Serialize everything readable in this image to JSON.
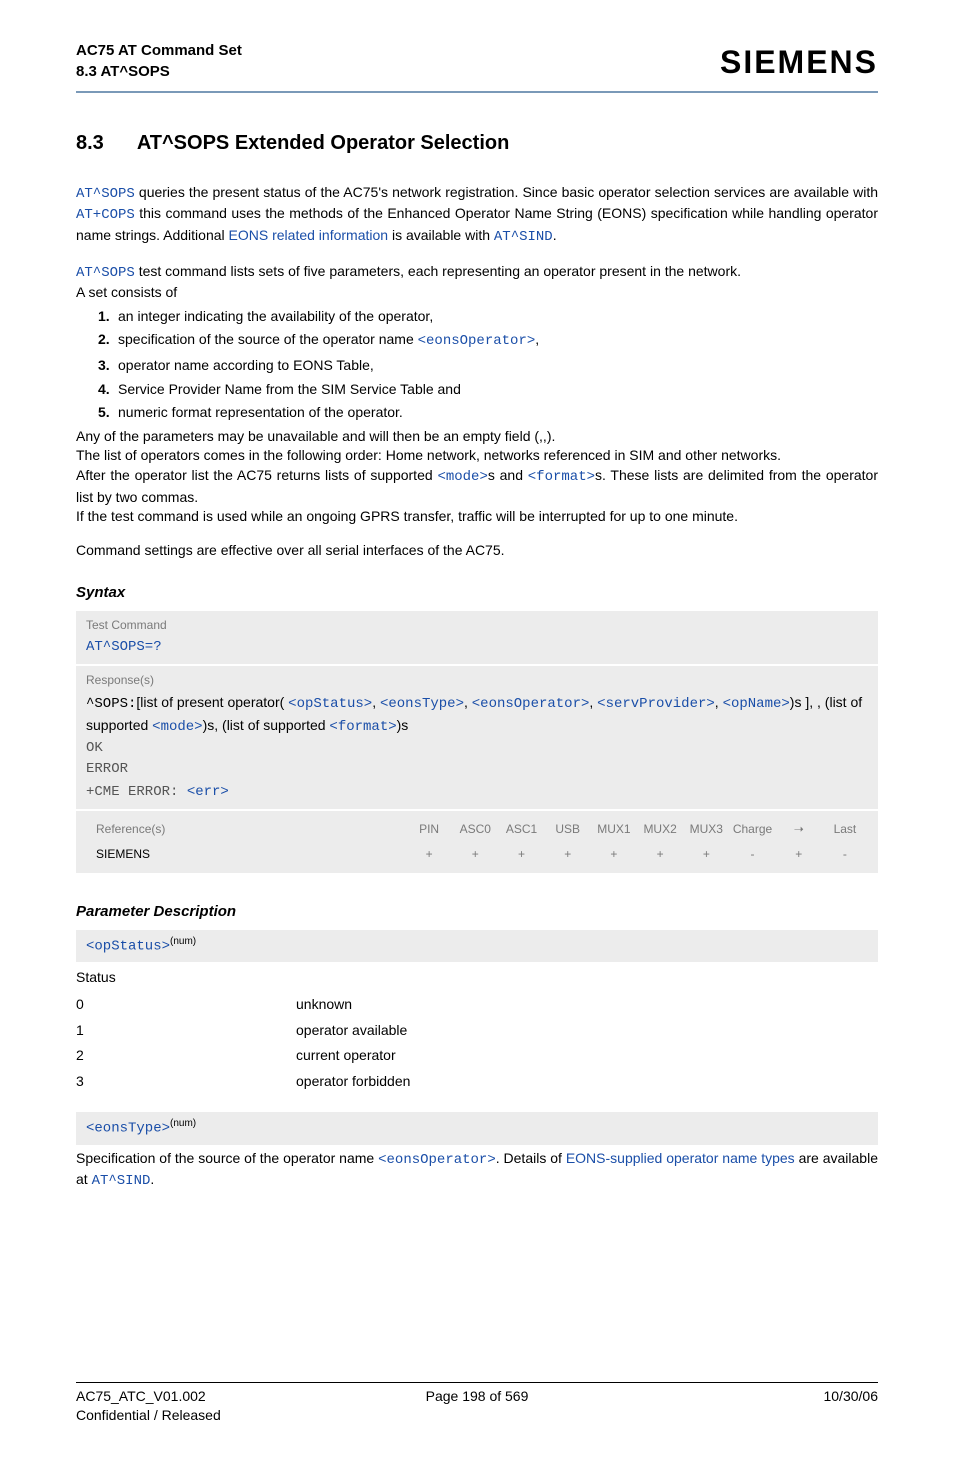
{
  "header": {
    "doc_title": "AC75 AT Command Set",
    "section_ref": "8.3 AT^SOPS",
    "brand": "SIEMENS"
  },
  "section": {
    "number": "8.3",
    "title": "AT^SOPS   Extended Operator Selection"
  },
  "intro": {
    "atsops1": "AT^SOPS",
    "p1a": " queries the present status of the AC75's network registration. Since basic operator selection services are available with ",
    "atcops": "AT+COPS",
    "p1b": " this command uses the methods of the Enhanced Operator Name String (EONS) specification while handling operator name strings. Additional ",
    "eons_link": "EONS related information",
    "p1c": " is available with ",
    "atsind": "AT^SIND",
    "p1d": "."
  },
  "testcmd": {
    "atsops2": "AT^SOPS",
    "p2": " test command lists sets of five parameters, each representing an operator present in the network.",
    "p3": "A set consists of",
    "items": {
      "i1": "an integer indicating the availability of the operator,",
      "i2a": "specification of the source of the operator name ",
      "i2code": "<eonsOperator>",
      "i2b": ",",
      "i3": "operator name according to EONS Table,",
      "i4": "Service Provider Name from the SIM Service Table and",
      "i5": "numeric format representation of the operator."
    },
    "p4": "Any of the parameters may be unavailable and will then be an empty field (,,).",
    "p5": "The list of operators comes in the following order: Home network, networks referenced in SIM and other networks.",
    "p6a": "After the operator list the AC75 returns lists of supported ",
    "mode": "<mode>",
    "p6b": "s and ",
    "format": "<format>",
    "p6c": "s. These lists are delimited from the operator list by two commas.",
    "p7": "If the test command is used while an ongoing GPRS transfer, traffic will be interrupted for up to one minute.",
    "p8": "Command settings are effective over all serial interfaces of the AC75."
  },
  "syntax": {
    "heading": "Syntax",
    "test_label": "Test Command",
    "test_cmd": "AT^SOPS=?",
    "resp_label": "Response(s)",
    "resp": {
      "pre": "^SOPS:",
      "t1": "[list of present operator( ",
      "opStatus": "<opStatus>",
      "c1": ", ",
      "eonsType": "<eonsType>",
      "c2": ", ",
      "eonsOperator": "<eonsOperator>",
      "c3": ", ",
      "servProvider": "<servProvider>",
      "c4": ", ",
      "opName": "<opName>",
      "t2": ")s ], , (list of supported ",
      "mode": "<mode>",
      "t3": ")s, (list of supported ",
      "format": "<format>",
      "t4": ")s",
      "ok": "OK",
      "error": "ERROR",
      "cme_pre": "+CME ERROR: ",
      "err": "<err>"
    },
    "ref_label": "Reference(s)",
    "cols": [
      "PIN",
      "ASC0",
      "ASC1",
      "USB",
      "MUX1",
      "MUX2",
      "MUX3",
      "Charge",
      "➝",
      "Last"
    ],
    "siemens": "SIEMENS",
    "vals": [
      "+",
      "+",
      "+",
      "+",
      "+",
      "+",
      "+",
      "-",
      "+",
      "-"
    ]
  },
  "paramdesc": {
    "heading": "Parameter Description",
    "opStatus": {
      "name": "<opStatus>",
      "sup": "(num)",
      "status_label": "Status",
      "rows": [
        {
          "v": "0",
          "d": "unknown"
        },
        {
          "v": "1",
          "d": "operator available"
        },
        {
          "v": "2",
          "d": "current operator"
        },
        {
          "v": "3",
          "d": "operator forbidden"
        }
      ]
    },
    "eonsType": {
      "name": "<eonsType>",
      "sup": "(num)",
      "p_a": "Specification of the source of the operator name ",
      "eonsOperator": "<eonsOperator>",
      "p_b": ". Details of ",
      "link": "EONS-supplied operator name types",
      "p_c": " are available at ",
      "atsind": "AT^SIND",
      "p_d": "."
    }
  },
  "footer": {
    "left1": "AC75_ATC_V01.002",
    "left2": "Confidential / Released",
    "center": "Page 198 of 569",
    "right": "10/30/06"
  }
}
